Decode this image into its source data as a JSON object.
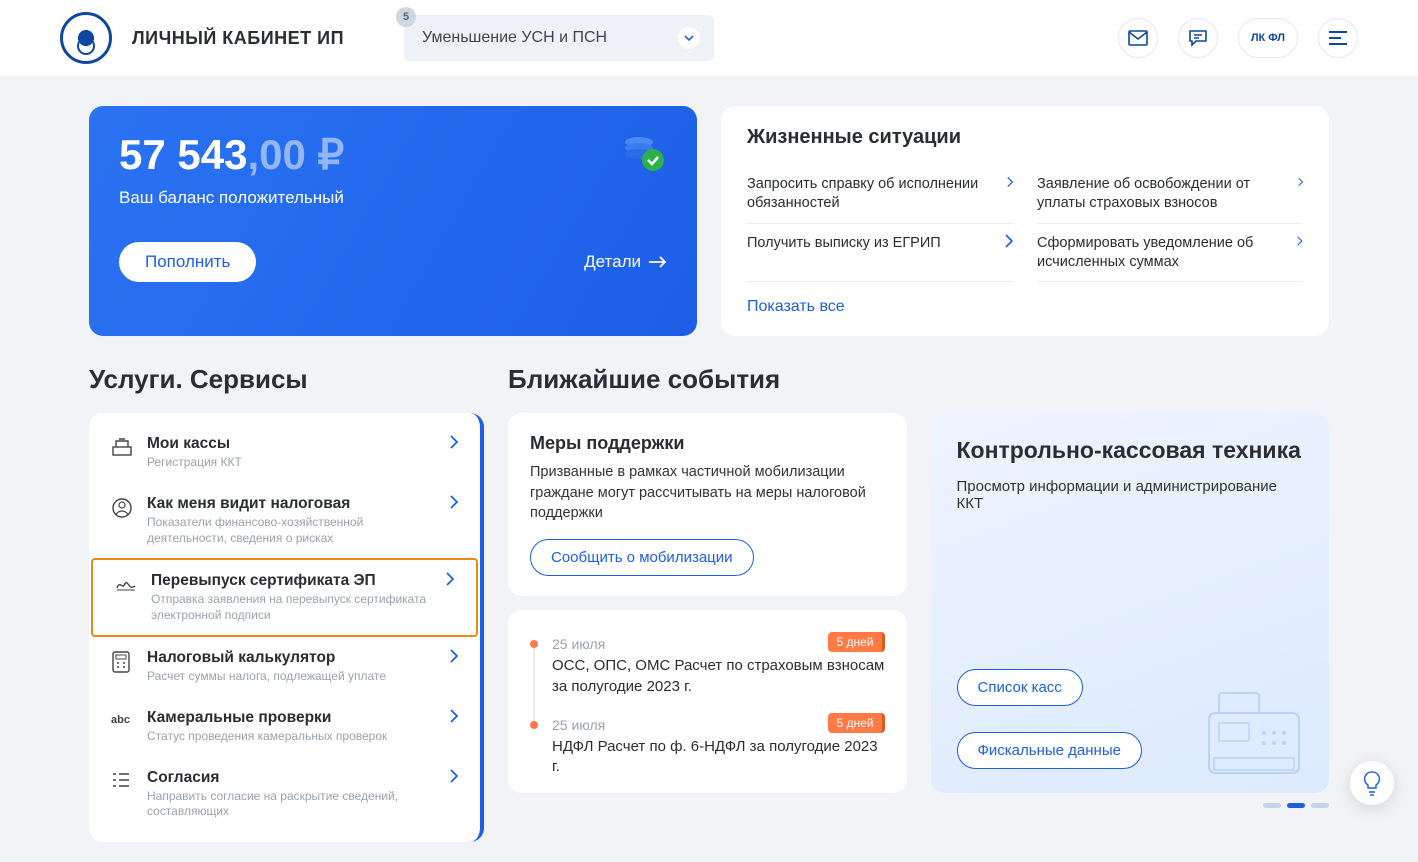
{
  "header": {
    "title": "ЛИЧНЫЙ КАБИНЕТ ИП",
    "dropdown": {
      "label": "Уменьшение УСН и ПСН",
      "badge": "5"
    },
    "lk_label": "ЛК ФЛ"
  },
  "balance": {
    "int": "57 543",
    "dec": ",00 ₽",
    "status": "Ваш баланс положительный",
    "topup": "Пополнить",
    "details": "Детали"
  },
  "situations": {
    "title": "Жизненные ситуации",
    "items": [
      "Запросить справку об исполнении обязанностей",
      "Заявление об освобождении от уплаты страховых взносов",
      "Получить выписку из ЕГРИП",
      "Сформировать уведомление об исчисленных суммах"
    ],
    "show_all": "Показать все"
  },
  "sections": {
    "services": "Услуги. Сервисы",
    "events": "Ближайшие события"
  },
  "services": [
    {
      "title": "Мои кассы",
      "sub": "Регистрация ККТ"
    },
    {
      "title": "Как меня видит налоговая",
      "sub": "Показатели финансово-хозяйственной деятельности, сведения о рисках"
    },
    {
      "title": "Перевыпуск сертификата ЭП",
      "sub": "Отправка заявления на перевыпуск сертификата электронной подписи"
    },
    {
      "title": "Налоговый калькулятор",
      "sub": "Расчет суммы налога, подлежащей уплате"
    },
    {
      "title": "Камеральные проверки",
      "sub": "Статус проведения камеральных проверок"
    },
    {
      "title": "Согласия",
      "sub": "Направить согласие на раскрытие сведений, составляющих"
    }
  ],
  "measures": {
    "title": "Меры поддержки",
    "text": "Призванные в рамках частичной мобилизации граждане могут рассчитывать на меры налоговой поддержки",
    "btn": "Сообщить о мобилизации"
  },
  "timeline": [
    {
      "date": "25 июля",
      "text": "ОСС, ОПС, ОМС Расчет по страховым взносам за полугодие 2023 г.",
      "badge": "5 дней"
    },
    {
      "date": "25 июля",
      "text": "НДФЛ Расчет по ф. 6-НДФЛ за полугодие 2023 г.",
      "badge": "5 дней"
    }
  ],
  "kkt": {
    "title": "Контрольно-кассовая техника",
    "text": "Просмотр информации и администрирование ККТ",
    "btn1": "Список касс",
    "btn2": "Фискальные данные"
  }
}
